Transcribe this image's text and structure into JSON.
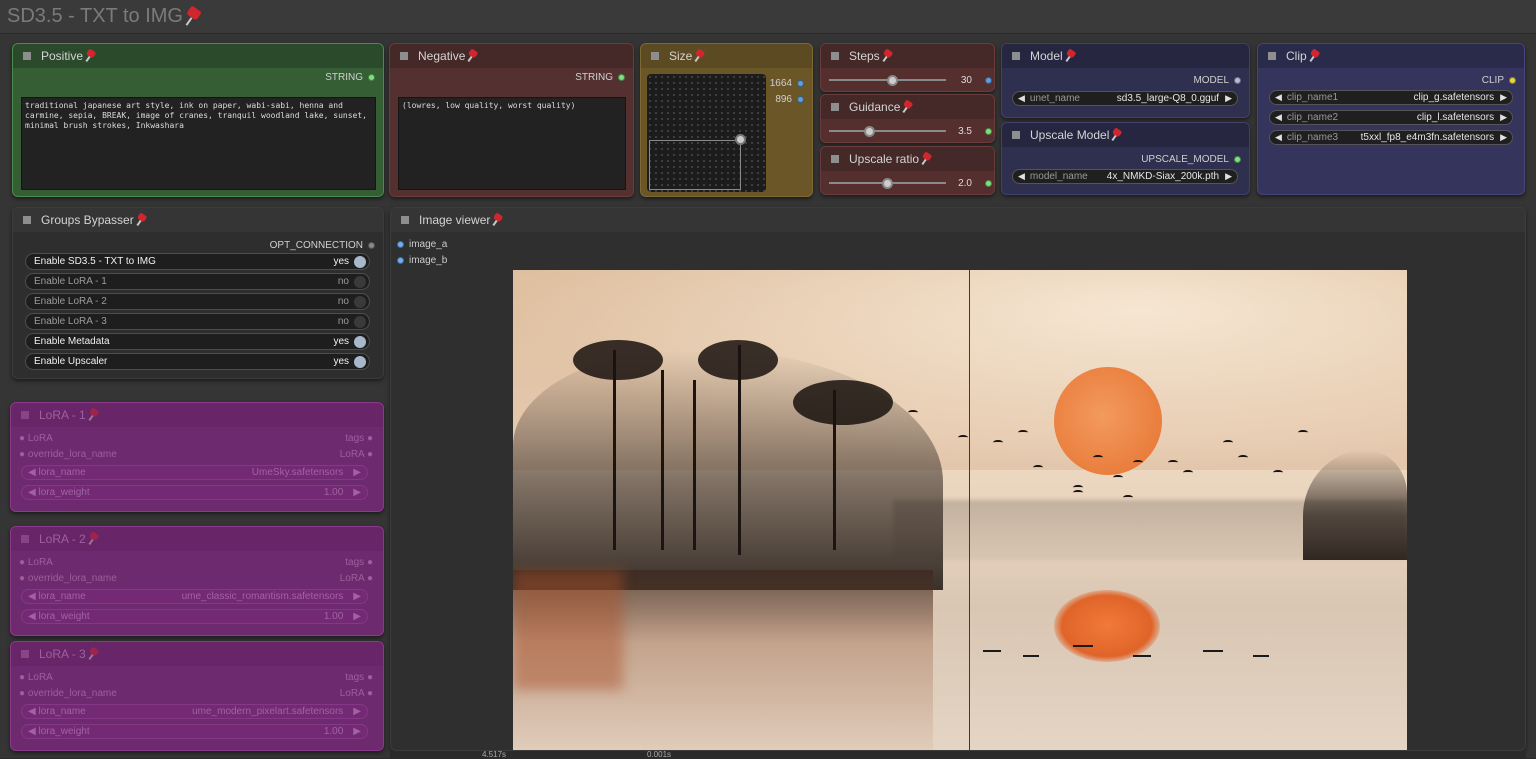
{
  "group": {
    "title": "SD3.5 - TXT to IMG"
  },
  "positive": {
    "title": "Positive",
    "output": "STRING",
    "text": "traditional japanese art style, ink on paper, wabi-sabi, henna and carmine, sepia, BREAK, image of cranes, tranquil woodland lake, sunset, minimal brush strokes, Inkwashara"
  },
  "negative": {
    "title": "Negative",
    "output": "STRING",
    "text": "(lowres, low quality, worst quality)"
  },
  "size": {
    "title": "Size",
    "width": "1664",
    "height": "896"
  },
  "steps": {
    "title": "Steps",
    "value": "30",
    "fraction": 0.55
  },
  "guidance": {
    "title": "Guidance",
    "value": "3.5",
    "fraction": 0.35
  },
  "upscale_ratio": {
    "title": "Upscale ratio",
    "value": "2.0",
    "fraction": 0.5
  },
  "model": {
    "title": "Model",
    "output": "MODEL",
    "widget_label": "unet_name",
    "widget_value": "sd3.5_large-Q8_0.gguf"
  },
  "upscale_model": {
    "title": "Upscale Model",
    "output": "UPSCALE_MODEL",
    "widget_label": "model_name",
    "widget_value": "4x_NMKD-Siax_200k.pth"
  },
  "clip": {
    "title": "Clip",
    "output": "CLIP",
    "rows": [
      {
        "label": "clip_name1",
        "value": "clip_g.safetensors"
      },
      {
        "label": "clip_name2",
        "value": "clip_l.safetensors"
      },
      {
        "label": "clip_name3",
        "value": "t5xxl_fp8_e4m3fn.safetensors"
      }
    ]
  },
  "bypasser": {
    "title": "Groups Bypasser",
    "output": "OPT_CONNECTION",
    "toggles": [
      {
        "label": "Enable SD3.5 - TXT to IMG",
        "value": "yes"
      },
      {
        "label": "Enable LoRA - 1",
        "value": "no"
      },
      {
        "label": "Enable LoRA - 2",
        "value": "no"
      },
      {
        "label": "Enable LoRA - 3",
        "value": "no"
      },
      {
        "label": "Enable Metadata",
        "value": "yes"
      },
      {
        "label": "Enable Upscaler",
        "value": "yes"
      }
    ]
  },
  "loras": [
    {
      "title": "LoRA - 1",
      "in1": "LoRA",
      "out1": "tags",
      "in2": "override_lora_name",
      "out2": "LoRA",
      "name_label": "lora_name",
      "name_value": "UmeSky.safetensors",
      "weight_label": "lora_weight",
      "weight_value": "1.00"
    },
    {
      "title": "LoRA - 2",
      "in1": "LoRA",
      "out1": "tags",
      "in2": "override_lora_name",
      "out2": "LoRA",
      "name_label": "lora_name",
      "name_value": "ume_classic_romantism.safetensors",
      "weight_label": "lora_weight",
      "weight_value": "1.00"
    },
    {
      "title": "LoRA - 3",
      "in1": "LoRA",
      "out1": "tags",
      "in2": "override_lora_name",
      "out2": "LoRA",
      "name_label": "lora_name",
      "name_value": "ume_modern_pixelart.safetensors",
      "weight_label": "lora_weight",
      "weight_value": "1.00"
    }
  ],
  "viewer": {
    "title": "Image viewer",
    "input_a": "image_a",
    "input_b": "image_b"
  },
  "footer": {
    "time_left": "4.517s",
    "time_right": "0.001s"
  },
  "colors": {
    "positive": "#2f5a2f",
    "negative": "#4f2b2b",
    "size": "#6a5524",
    "numeric": "#4e2a2a",
    "model": "#2c2c48",
    "lora": "#7a2a7a",
    "dot_green": "#7de07d",
    "dot_blue": "#5a9fe0",
    "dot_yellow": "#e6d34a"
  }
}
